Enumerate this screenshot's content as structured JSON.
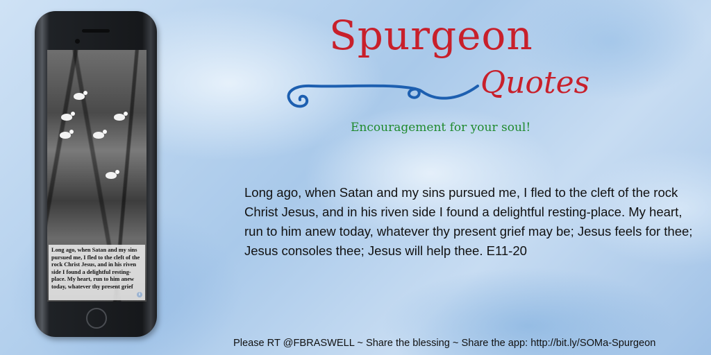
{
  "title": "Spurgeon",
  "subtitle": "Quotes",
  "tagline": "Encouragement for your soul!",
  "quote": "Long ago, when Satan and my sins pursued me, I fled to the cleft of the rock Christ Jesus, and in his riven side I found a delightful resting-place. My heart, run to him anew today, whatever thy present grief may be; Jesus feels for thee; Jesus consoles thee; Jesus will help thee. E11-20",
  "phone": {
    "screen_caption": "Long ago, when Satan and my sins pursued me, I fled to the cleft of the rock Christ Jesus, and in his riven side I found a delightful resting-place. My heart, run to him anew today, whatever thy present grief"
  },
  "footer": "Please RT @FBRASWELL ~ Share the blessing ~ Share the app: http://bit.ly/SOMa-Spurgeon",
  "colors": {
    "title": "#c8202b",
    "tagline": "#1f8a2e",
    "swash": "#1d5fb0",
    "background": "#b9d4ef"
  }
}
